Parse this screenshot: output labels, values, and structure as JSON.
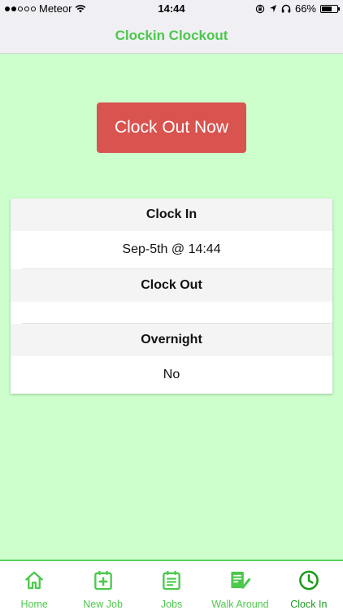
{
  "status_bar": {
    "carrier": "Meteor",
    "time": "14:44",
    "battery": "66%",
    "battery_level": 0.66
  },
  "nav": {
    "title": "Clockin Clockout"
  },
  "action": {
    "clock_out_label": "Clock Out Now"
  },
  "card": {
    "clock_in_label": "Clock In",
    "clock_in_value": "Sep-5th @ 14:44",
    "clock_out_label": "Clock Out",
    "clock_out_value": "",
    "overnight_label": "Overnight",
    "overnight_value": "No"
  },
  "tabs": [
    {
      "label": "Home",
      "icon": "home-icon"
    },
    {
      "label": "New Job",
      "icon": "add-box-icon"
    },
    {
      "label": "Jobs",
      "icon": "list-icon"
    },
    {
      "label": "Walk Around",
      "icon": "checklist-icon"
    },
    {
      "label": "Clock In",
      "icon": "clock-icon",
      "active": true
    }
  ],
  "colors": {
    "background": "#ccffcc",
    "accent": "#4cc84c",
    "danger_button": "#d9534f"
  }
}
